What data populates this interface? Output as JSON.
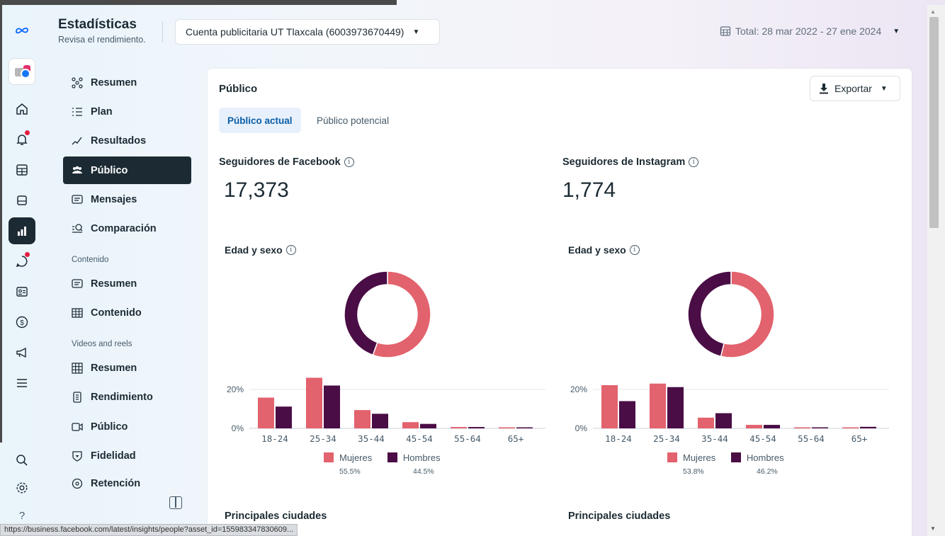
{
  "header": {
    "title": "Estadísticas",
    "subtitle": "Revisa el rendimiento.",
    "account": "Cuenta publicitaria UT Tlaxcala (6003973670449)",
    "date_range": "Total: 28 mar 2022 - 27 ene 2024"
  },
  "rail": {
    "items": [
      "meta-logo-icon",
      "account-avatar",
      "home-icon",
      "notifications-icon",
      "table-icon",
      "pages-icon",
      "insights-icon",
      "chat-icon",
      "contacts-icon",
      "billing-icon",
      "ads-icon",
      "menu-icon",
      "search-icon",
      "settings-icon",
      "help-icon"
    ],
    "help_label": "?"
  },
  "sidebar": {
    "items": [
      {
        "label": "Resumen",
        "icon": "overview-icon"
      },
      {
        "label": "Plan",
        "icon": "plan-icon"
      },
      {
        "label": "Resultados",
        "icon": "results-icon"
      },
      {
        "label": "Público",
        "icon": "audience-icon"
      },
      {
        "label": "Mensajes",
        "icon": "messages-icon"
      },
      {
        "label": "Comparación",
        "icon": "compare-icon"
      }
    ],
    "content_section": "Contenido",
    "content_items": [
      {
        "label": "Resumen",
        "icon": "content-overview-icon"
      },
      {
        "label": "Contenido",
        "icon": "content-table-icon"
      }
    ],
    "video_section": "Videos and reels",
    "video_items": [
      {
        "label": "Resumen",
        "icon": "grid-icon"
      },
      {
        "label": "Rendimiento",
        "icon": "performance-icon"
      },
      {
        "label": "Público",
        "icon": "video-audience-icon"
      },
      {
        "label": "Fidelidad",
        "icon": "loyalty-icon"
      },
      {
        "label": "Retención",
        "icon": "retention-icon"
      }
    ]
  },
  "main": {
    "title": "Público",
    "export_label": "Exportar",
    "tabs": [
      {
        "label": "Público actual",
        "active": true
      },
      {
        "label": "Público potencial",
        "active": false
      }
    ],
    "facebook": {
      "label": "Seguidores de Facebook",
      "value": "17,373"
    },
    "instagram": {
      "label": "Seguidores de Instagram",
      "value": "1,774"
    },
    "age_gender_label": "Edad y sexo",
    "cities_label": "Principales ciudades"
  },
  "chart_data": [
    {
      "type": "bar",
      "title": "Edad y sexo",
      "categories": [
        "18-24",
        "25-34",
        "35-44",
        "45-54",
        "55-64",
        "65+"
      ],
      "series": [
        {
          "name": "Mujeres",
          "values": [
            15.8,
            26.0,
            9.4,
            3.2,
            0.7,
            0.4
          ],
          "color": "#e2626d"
        },
        {
          "name": "Hombres",
          "values": [
            11.2,
            22.0,
            7.5,
            2.3,
            0.7,
            0.5
          ],
          "color": "#4a0d45"
        }
      ],
      "yticks": [
        "0%",
        "20%"
      ],
      "ylim": [
        0,
        30
      ],
      "donut": {
        "Mujeres": 55.5,
        "Hombres": 44.5
      },
      "legend_pcts": [
        "55.5%",
        "44.5%"
      ]
    },
    {
      "type": "bar",
      "title": "Edad y sexo",
      "categories": [
        "18-24",
        "25-34",
        "35-44",
        "45-54",
        "55-64",
        "65+"
      ],
      "series": [
        {
          "name": "Mujeres",
          "values": [
            22.2,
            23.0,
            5.5,
            1.8,
            0.5,
            0.3
          ],
          "color": "#e2626d"
        },
        {
          "name": "Hombres",
          "values": [
            14.0,
            21.2,
            7.8,
            1.8,
            0.5,
            0.8
          ],
          "color": "#4a0d45"
        }
      ],
      "yticks": [
        "0%",
        "20%"
      ],
      "ylim": [
        0,
        30
      ],
      "donut": {
        "Mujeres": 53.8,
        "Hombres": 46.2
      },
      "legend_pcts": [
        "53.8%",
        "46.2%"
      ]
    }
  ],
  "status_url": "https://business.facebook.com/latest/insights/people?asset_id=155983347830609..."
}
